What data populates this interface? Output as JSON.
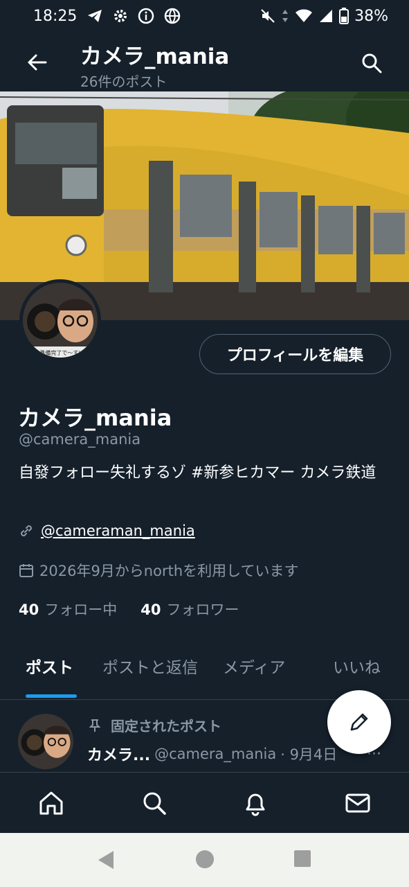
{
  "status_bar": {
    "time": "18:25",
    "battery": "38%",
    "icons": [
      "telegram-icon",
      "settings-icon",
      "info-icon",
      "vpn-globe-icon",
      "mute-icon",
      "data-arrows-icon",
      "wifi-icon",
      "signal-icon",
      "battery-icon"
    ]
  },
  "header": {
    "title": "カメラ_mania",
    "subtitle": "26件のポスト",
    "icons": [
      "back-arrow-icon",
      "search-icon"
    ]
  },
  "avatar": {
    "caption": "準備完了で〜す!"
  },
  "profile": {
    "edit_button": "プロフィールを編集",
    "name": "カメラ_mania",
    "handle": "@camera_mania",
    "bio": "自發フォロー失礼するゾ #新参ヒカマー カメラ鉄道",
    "link": "@cameraman_mania",
    "joined": "2026年9月からnorthを利用しています",
    "following_count": "40",
    "following_label": "フォロー中",
    "followers_count": "40",
    "followers_label": "フォロワー"
  },
  "tabs": [
    {
      "label": "ポスト",
      "active": true
    },
    {
      "label": "ポストと返信",
      "active": false
    },
    {
      "label": "メディア",
      "active": false
    },
    {
      "label": "いいね",
      "active": false
    }
  ],
  "pinned_post": {
    "pinned_label": "固定されたポスト",
    "name": "カメラ...",
    "handle": "@camera_mania",
    "date": "· 9月4日",
    "more": "···"
  },
  "fab": {
    "icon": "pencil-icon"
  },
  "bottom_nav": [
    "home-icon",
    "search-icon",
    "bell-icon",
    "mail-icon"
  ],
  "system_nav": [
    "back-triangle-icon",
    "home-circle-icon",
    "recents-square-icon"
  ],
  "colors": {
    "background": "#15202b",
    "text": "#ffffff",
    "secondary_text": "#8b98a5",
    "accent": "#1d9bf0",
    "divider": "#38444d",
    "train_yellow": "#e2b431"
  }
}
